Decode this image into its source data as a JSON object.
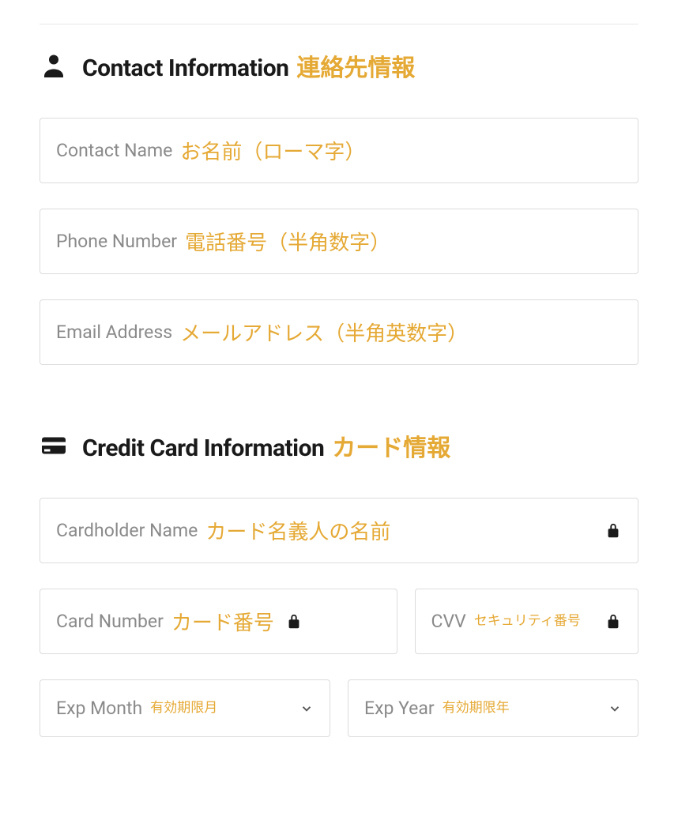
{
  "contact": {
    "title_en": "Contact Information",
    "title_jp": "連絡先情報",
    "fields": {
      "name_en": "Contact Name",
      "name_jp": "お名前（ローマ字）",
      "phone_en": "Phone Number",
      "phone_jp": "電話番号（半角数字）",
      "email_en": "Email Address",
      "email_jp": "メールアドレス（半角英数字）"
    }
  },
  "card": {
    "title_en": "Credit Card Information",
    "title_jp": "カード情報",
    "fields": {
      "holder_en": "Cardholder Name",
      "holder_jp": "カード名義人の名前",
      "number_en": "Card Number",
      "number_jp": "カード番号",
      "cvv_en": "CVV",
      "cvv_jp": "セキュリティ番号",
      "expmonth_en": "Exp Month",
      "expmonth_jp": "有効期限月",
      "expyear_en": "Exp Year",
      "expyear_jp": "有効期限年"
    }
  }
}
